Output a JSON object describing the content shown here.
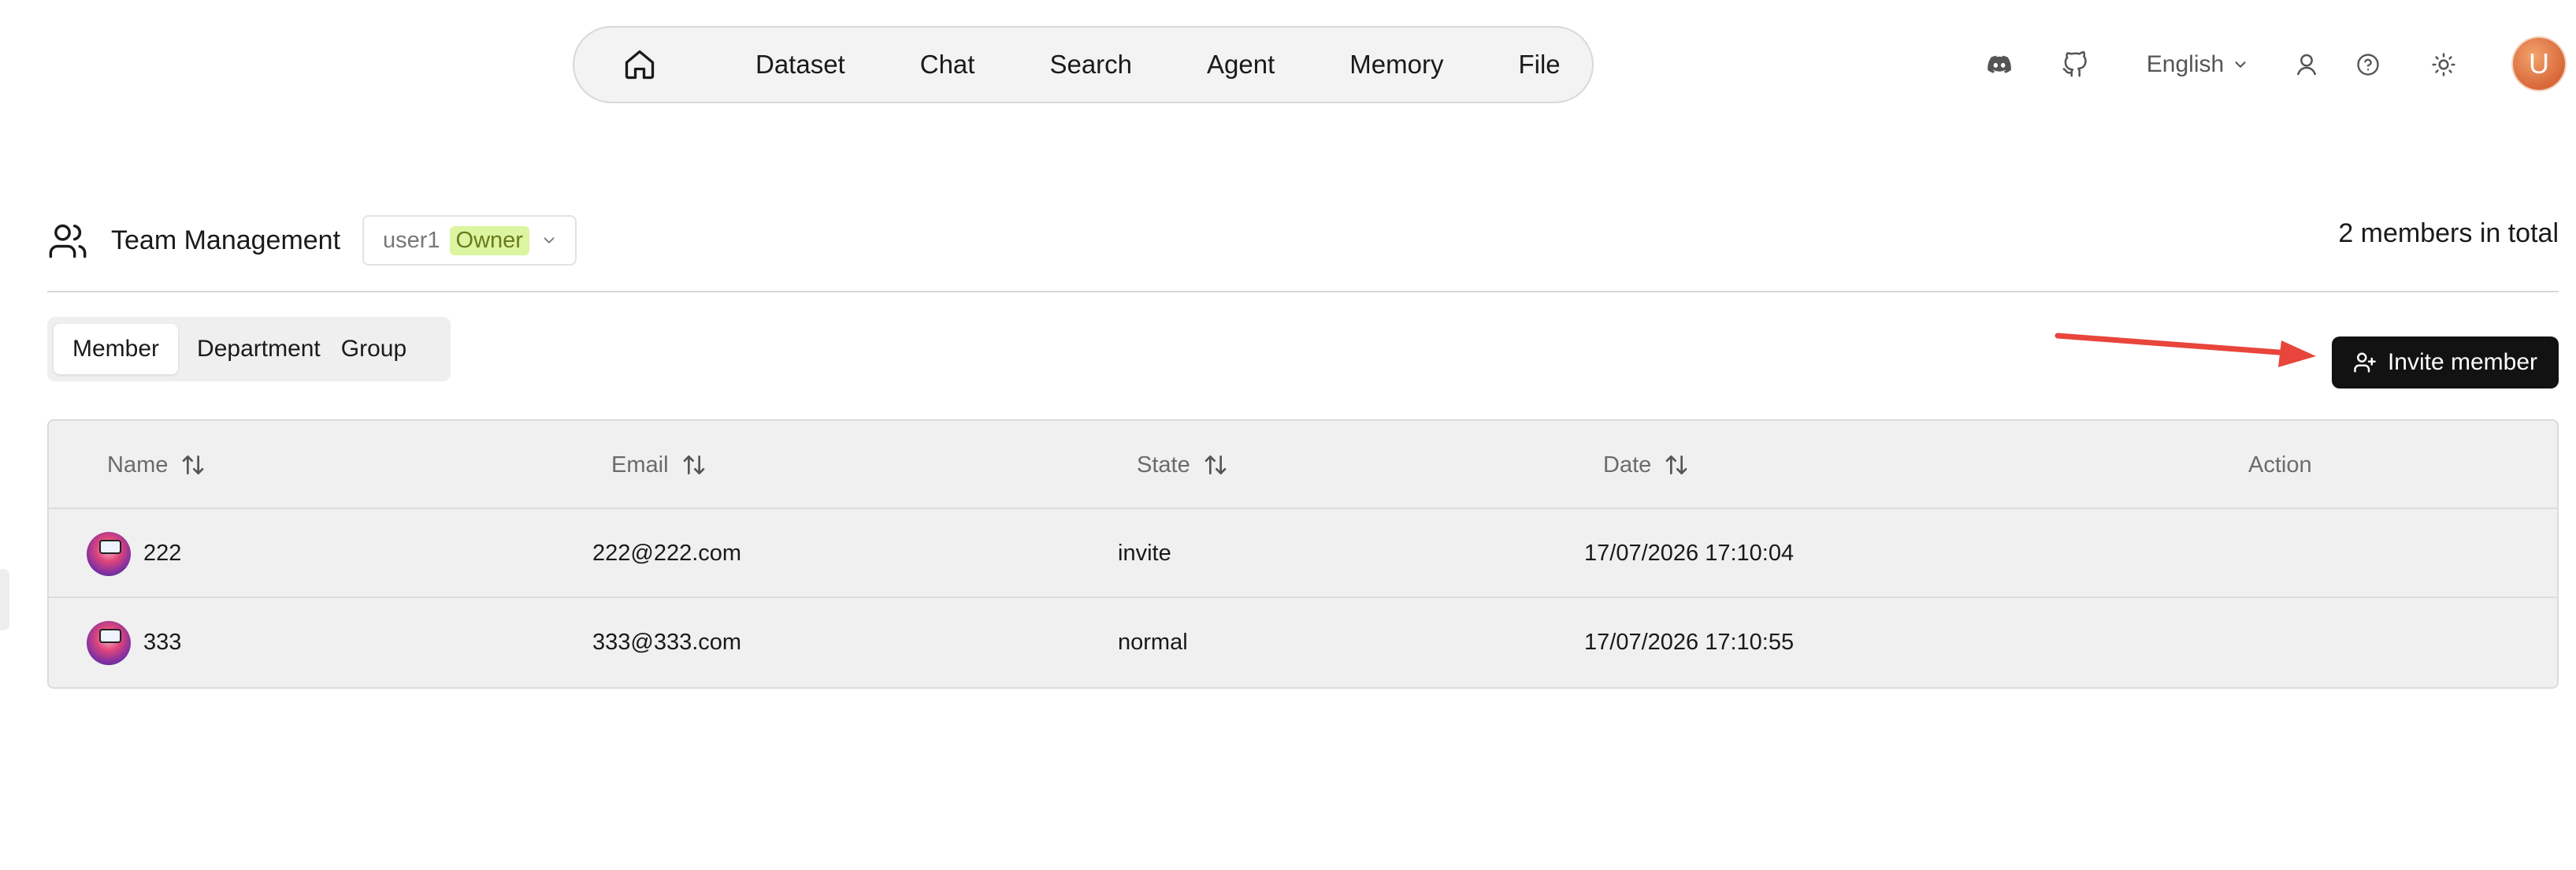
{
  "nav": {
    "items": [
      "Dataset",
      "Chat",
      "Search",
      "Agent",
      "Memory",
      "File"
    ]
  },
  "header_tools": {
    "language": "English",
    "avatar_initial": "U"
  },
  "team": {
    "title": "Team Management",
    "selected_user": "user1",
    "role_badge": "Owner",
    "members_total": "2 members in total"
  },
  "tabs": [
    "Member",
    "Department",
    "Group"
  ],
  "invite_button": "Invite member",
  "table": {
    "columns": [
      "Name",
      "Email",
      "State",
      "Date",
      "Action"
    ],
    "rows": [
      {
        "name": "222",
        "email": "222@222.com",
        "state": "invite",
        "date": "17/07/2026 17:10:04"
      },
      {
        "name": "333",
        "email": "333@333.com",
        "state": "normal",
        "date": "17/07/2026 17:10:55"
      }
    ]
  },
  "colors": {
    "primary_button": "#121212",
    "owner_badge_bg": "#dcf5a0",
    "annotation_arrow": "#e8453c",
    "avatar_accent": "#d9673a"
  },
  "icons": [
    "home-icon",
    "discord-icon",
    "github-icon",
    "chevron-down-icon",
    "user-icon",
    "help-icon",
    "sun-icon",
    "team-icon",
    "user-plus-icon",
    "sort-icon"
  ]
}
